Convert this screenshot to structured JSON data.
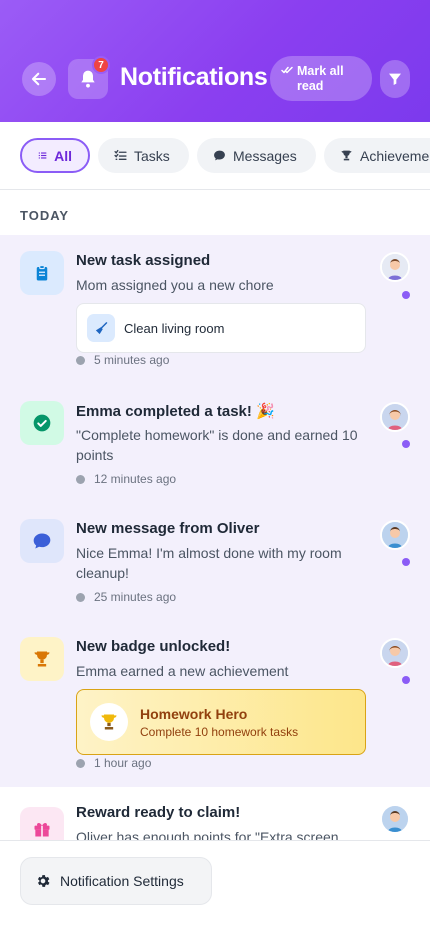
{
  "header": {
    "title": "Notifications",
    "unread_count": "7",
    "mark_all_read": "Mark all read",
    "colors": {
      "gradient_start": "#9b5cf6",
      "gradient_end": "#7c3aed",
      "badge": "#ef4444"
    }
  },
  "tabs": [
    {
      "label": "All",
      "icon": "list-icon",
      "active": true
    },
    {
      "label": "Tasks",
      "icon": "checklist-icon",
      "active": false
    },
    {
      "label": "Messages",
      "icon": "chat-bubble-icon",
      "active": false
    },
    {
      "label": "Achievements",
      "icon": "trophy-icon",
      "active": false
    }
  ],
  "section": {
    "label": "TODAY"
  },
  "notifications": [
    {
      "title": "New task assigned",
      "body": "Mom assigned you a new chore",
      "chip": "Clean living room",
      "time": "5 minutes ago",
      "icon": "clipboard-icon",
      "unread": true
    },
    {
      "title": "Emma completed a task! 🎉",
      "body": "\"Complete homework\" is done and earned 10 points",
      "time": "12 minutes ago",
      "icon": "check-circle-icon",
      "unread": true
    },
    {
      "title": "New message from Oliver",
      "body": "Nice Emma! I'm almost done with my room cleanup!",
      "time": "25 minutes ago",
      "icon": "chat-bubble-icon",
      "unread": true
    },
    {
      "title": "New badge unlocked!",
      "body": "Emma earned a new achievement",
      "badge_title": "Homework Hero",
      "badge_sub": "Complete 10 homework tasks",
      "time": "1 hour ago",
      "icon": "trophy-icon",
      "unread": true
    },
    {
      "title": "Reward ready to claim!",
      "body": "Oliver has enough points for \"Extra screen",
      "icon": "gift-icon",
      "unread": false
    }
  ],
  "footer": {
    "settings_label": "Notification Settings"
  }
}
